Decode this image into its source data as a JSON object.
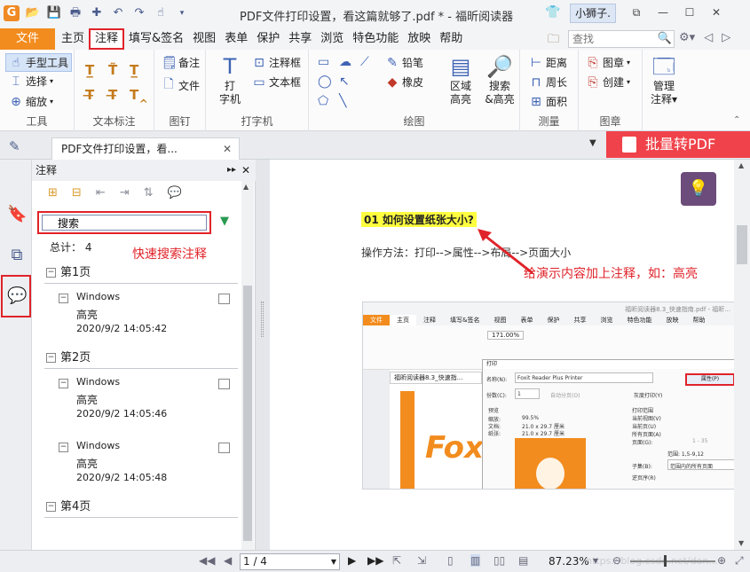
{
  "window": {
    "title": "PDF文件打印设置，看这篇就够了.pdf * - 福昕阅读器",
    "user": "小狮子.",
    "qat_icons": [
      "app-logo-icon",
      "open-folder-icon",
      "save-icon",
      "print-icon",
      "new-icon",
      "undo-icon",
      "redo-icon",
      "hand-icon",
      "dropdown-icon"
    ]
  },
  "menu": {
    "file_label": "文件",
    "tabs": [
      "主页",
      "注释",
      "填写&签名",
      "视图",
      "表单",
      "保护",
      "共享",
      "浏览",
      "特色功能",
      "放映",
      "帮助"
    ],
    "active_tab": "注释",
    "search_placeholder": "查找"
  },
  "ribbon": {
    "tools": {
      "hand": "手型工具",
      "select": "选择",
      "zoom": "缩放",
      "label": "工具"
    },
    "text_markup": {
      "label": "文本标注"
    },
    "pin": {
      "note": "备注",
      "file": "文件",
      "label": "图钉"
    },
    "typewriter": {
      "big": "打\n字机",
      "callout": "注释框",
      "textbox": "文本框",
      "label": "打字机"
    },
    "drawing": {
      "pencil": "铅笔",
      "eraser": "橡皮",
      "area": "区域\n高亮",
      "search_highlight": "搜索\n&高亮",
      "label": "绘图"
    },
    "measure": {
      "distance": "距离",
      "perimeter": "周长",
      "area": "面积",
      "label": "测量"
    },
    "stamp": {
      "stamp": "图章",
      "create": "创建",
      "label": "图章"
    },
    "manage": {
      "label": "管理\n注释"
    }
  },
  "docbar": {
    "doc_tab": "PDF文件打印设置，看...",
    "promo": "批量转PDF"
  },
  "panel": {
    "title": "注释",
    "search_value": "搜索",
    "total": "总计：  4",
    "callout_quick_search": "快速搜索注释",
    "pages": [
      {
        "label": "第1页",
        "items": [
          {
            "author": "Windows",
            "type": "高亮",
            "time": "2020/9/2 14:05:42"
          }
        ]
      },
      {
        "label": "第2页",
        "items": [
          {
            "author": "Windows",
            "type": "高亮",
            "time": "2020/9/2 14:05:46"
          },
          {
            "author": "Windows",
            "type": "高亮",
            "time": "2020/9/2 14:05:48"
          }
        ]
      },
      {
        "label": "第4页",
        "items": []
      }
    ]
  },
  "document": {
    "heading": "01  如何设置纸张大小?",
    "method": "操作方法：打印-->属性-->布局-->页面大小",
    "annotation_note": "给演示内容加上注释，如：高亮"
  },
  "embedded": {
    "title": "福昕阅读器8.3_快速指南.pdf - 福昕...",
    "menu": [
      "文件",
      "主页",
      "注释",
      "填写&签名",
      "视图",
      "表单",
      "保护",
      "共享",
      "浏览",
      "特色功能",
      "放映",
      "帮助"
    ],
    "zoom": "171.00%",
    "tab": "福昕阅读器8.3_快速指...",
    "print_title": "打印",
    "printer_label": "名称(N):",
    "printer": "Foxit Reader Plus Printer",
    "properties": "属性(P)",
    "copies_label": "份数(C):",
    "copies": "1",
    "collate": "自动分页(O)",
    "grayscale": "灰度打印(Y)",
    "preview_label": "预览",
    "zoom_label": "缩放:",
    "zoom_val": "99.5%",
    "doc_label": "文档:",
    "doc_size": "21.0 x 29.7 厘米",
    "paper_label": "纸张:",
    "paper_size": "21.0 x 29.7 厘米",
    "range_label": "打印范围",
    "range_opts": [
      "当前视图(V)",
      "当前页(U)",
      "所有页面(A)",
      "页面(G):"
    ],
    "pages_hint": "1 - 35",
    "range_example": "范围: 1,5-9,12",
    "subset_label": "子集(B):",
    "subset": "范围内的所有页面",
    "reverse": "逆页序(R)",
    "fox": "Fox"
  },
  "status": {
    "page": "1 / 4",
    "zoom": "87.23%",
    "watermark": "https://blog.csdn.net/dan..."
  }
}
